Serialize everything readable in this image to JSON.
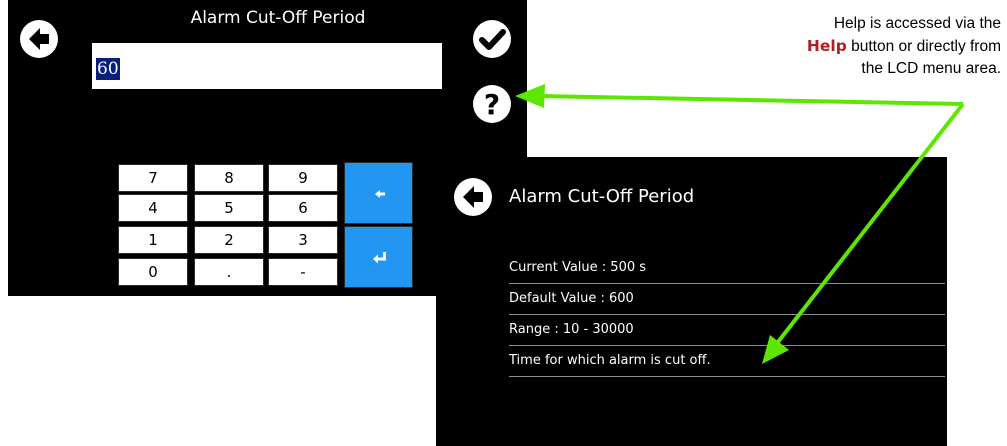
{
  "keypad_screen": {
    "title": "Alarm Cut-Off Period",
    "entry_value": "60",
    "icons": {
      "back": "back-arrow-icon",
      "confirm": "checkmark-icon",
      "help": "question-mark-icon"
    },
    "keys": [
      {
        "label": "7"
      },
      {
        "label": "8"
      },
      {
        "label": "9"
      },
      {
        "label": "4"
      },
      {
        "label": "5"
      },
      {
        "label": "6"
      },
      {
        "label": "1"
      },
      {
        "label": "2"
      },
      {
        "label": "3"
      },
      {
        "label": "0"
      },
      {
        "label": "."
      },
      {
        "label": "-"
      }
    ],
    "backspace_key": {
      "icon": "backspace-arrow-icon"
    },
    "enter_key": {
      "icon": "enter-return-icon"
    }
  },
  "help_screen": {
    "title": "Alarm Cut-Off Period",
    "back_icon": "back-arrow-icon",
    "lines": [
      "Current Value :  500 s",
      "Default Value :  600",
      "Range :  10 - 30000",
      "Time for which alarm is cut off."
    ]
  },
  "annotation": {
    "line1": "Help is accessed via the",
    "bold_word": "Help",
    "line2_rest": " button or directly from",
    "line3": "the LCD menu area.",
    "arrow_color": "#5ce600"
  },
  "colors": {
    "screen_bg": "#000000",
    "accent_blue": "#2396f3",
    "selection_bg": "#0a1f7a",
    "help_word": "#b01e22"
  }
}
